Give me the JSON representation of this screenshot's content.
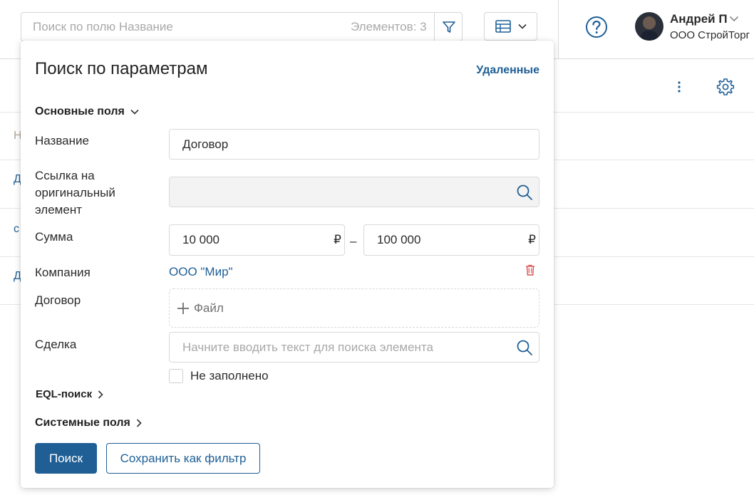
{
  "topbar": {
    "search_placeholder": "Поиск по полю Название",
    "elements_count": "Элементов: 3",
    "filter_icon": "filter-icon",
    "view_icon": "table-icon",
    "help_icon": "help-icon",
    "user": {
      "name": "Андрей П",
      "company": "ООО СтройТорг"
    }
  },
  "background_list": {
    "header_initial": "Н",
    "rows": [
      "Д",
      "с",
      "Д"
    ]
  },
  "panel": {
    "title": "Поиск по параметрам",
    "deleted_link": "Удаленные",
    "sections": {
      "main": "Основные поля",
      "eql": "EQL-поиск",
      "system": "Системные поля"
    },
    "fields": {
      "name_label": "Название",
      "name_value": "Договор",
      "link_label": "Ссылка на оригинальный элемент",
      "sum_label": "Сумма",
      "sum_from": "10 000",
      "sum_to": "100 000",
      "currency": "₽",
      "range_dash": "–",
      "company_label": "Компания",
      "company_value": "ООО \"Мир\"",
      "contract_label": "Договор",
      "file_label": "Файл",
      "deal_label": "Сделка",
      "deal_placeholder": "Начните вводить текст для поиска элемента",
      "empty_checkbox_label": "Не заполнено"
    },
    "buttons": {
      "search": "Поиск",
      "save_filter": "Сохранить как фильтр"
    }
  },
  "colors": {
    "accent": "#1f5f96",
    "danger": "#d9534f",
    "border": "#d9d9d9"
  }
}
